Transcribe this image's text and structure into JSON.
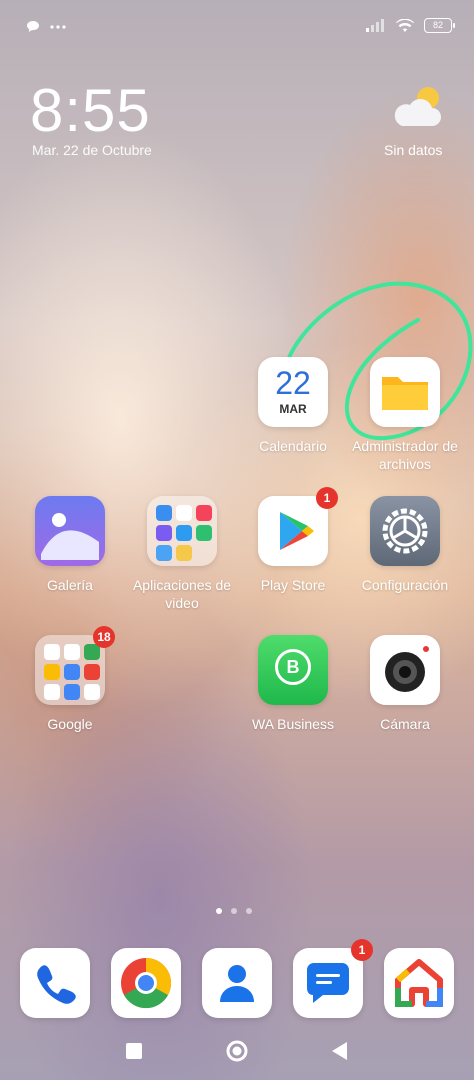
{
  "status_bar": {
    "battery": "82",
    "left_icons": [
      "chat-bubble-icon",
      "more-dots-icon"
    ],
    "right_icons": [
      "signal-icon",
      "wifi-icon",
      "battery-icon"
    ]
  },
  "lock_widget": {
    "time": "8:55",
    "date": "Mar. 22 de Octubre",
    "weather": "Sin datos",
    "weather_icon": "partly-cloudy-icon"
  },
  "apps": {
    "calendario": {
      "label": "Calendario",
      "day": "22",
      "month": "MAR"
    },
    "archivos": {
      "label": "Administrador de archivos"
    },
    "galeria": {
      "label": "Galería"
    },
    "videos": {
      "label": "Aplicaciones de video"
    },
    "playstore": {
      "label": "Play Store",
      "badge": "1"
    },
    "config": {
      "label": "Configuración"
    },
    "google": {
      "label": "Google",
      "badge": "18"
    },
    "wa": {
      "label": "WA Business",
      "letter": "B"
    },
    "camara": {
      "label": "Cámara"
    }
  },
  "dock": {
    "items": [
      "phone-icon",
      "chrome-icon",
      "contacts-icon",
      "messages-icon",
      "home-icon"
    ],
    "messages_badge": "1"
  },
  "page_indicator": {
    "count": 3,
    "active": 1
  },
  "nav_bar": [
    "recents-button",
    "home-button",
    "back-button"
  ],
  "annotation_color": "#3ee59a"
}
